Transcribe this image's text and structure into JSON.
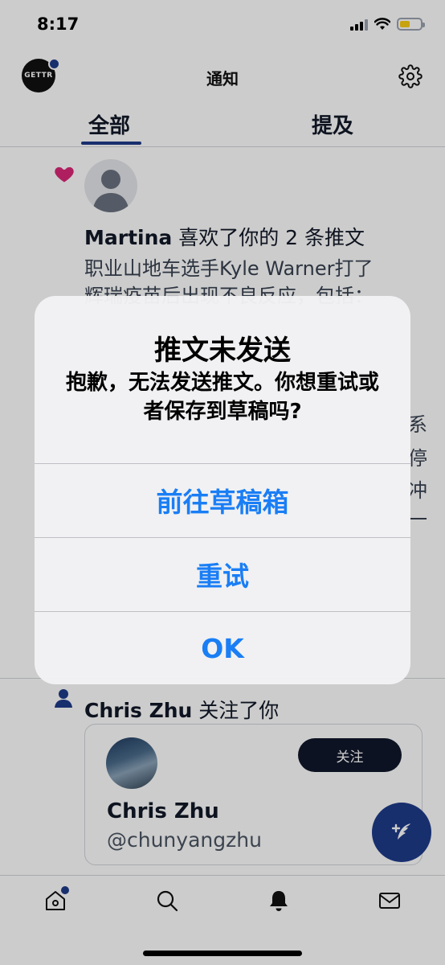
{
  "status_bar": {
    "time": "8:17"
  },
  "header": {
    "logo_text": "GETTR",
    "title": "通知"
  },
  "tabs": [
    {
      "label": "全部"
    },
    {
      "label": "提及"
    }
  ],
  "notifications": {
    "like": {
      "user": "Martina",
      "action": " 喜欢了你的 2 条推文",
      "tweet_line1": "职业山地车选手Kyle Warner打了",
      "tweet_line2": "辉瑞疫苗后出现不良反应，包括：",
      "peek_chars": [
        "系",
        "停",
        "冲",
        "一"
      ]
    },
    "follow": {
      "user": "Chris Zhu",
      "action": " 关注了你",
      "card_name": "Chris Zhu",
      "card_handle": "@chunyangzhu",
      "follow_label": "关注"
    }
  },
  "alert": {
    "title": "推文未发送",
    "message": "抱歉，无法发送推文。你想重试或者保存到草稿吗?",
    "buttons": [
      "前往草稿箱",
      "重试",
      "OK"
    ]
  },
  "icons": {
    "gear": "gear-icon",
    "heart": "heart-icon",
    "person": "person-icon",
    "home": "home-icon",
    "search": "search-icon",
    "bell": "bell-icon",
    "mail": "mail-icon",
    "fab": "compose-icon"
  },
  "colors": {
    "accent": "#1f3b8a",
    "heart": "#db2777",
    "alert_button": "#1a7ef5",
    "follow_button": "#0f172a"
  }
}
